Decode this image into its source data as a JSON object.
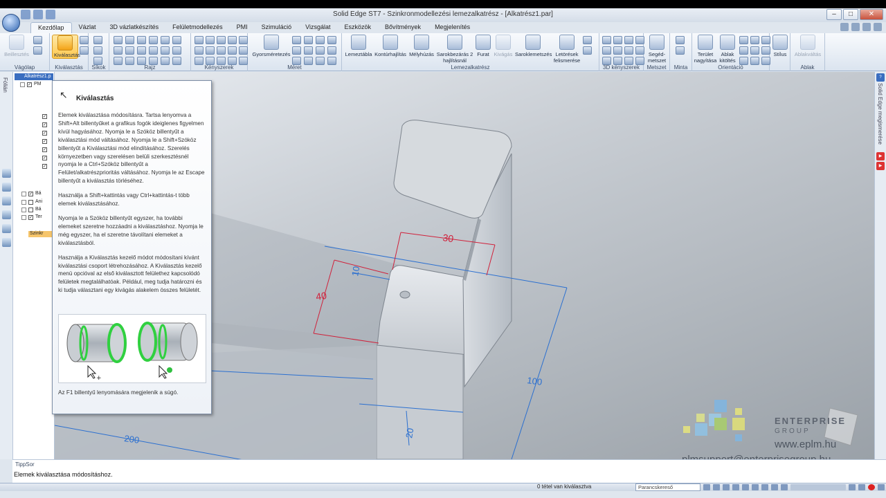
{
  "window": {
    "title": "Solid Edge ST7 - Szinkronmodellezési lemezalkatrész - [Alkatrész1.par]"
  },
  "tabs": [
    "Kezdőlap",
    "Vázlat",
    "3D vázlatkészítés",
    "Felületmodellezés",
    "PMI",
    "Szimuláció",
    "Vizsgálat",
    "Eszközök",
    "Bővítmények",
    "Megjelenítés"
  ],
  "ribbon": {
    "groups": [
      {
        "label": "Vágólap",
        "buttons": [
          "Beillesztés"
        ]
      },
      {
        "label": "Kiválasztás",
        "buttons": [
          "Kiválasztás"
        ]
      },
      {
        "label": "Síkok",
        "buttons": []
      },
      {
        "label": "Rajz",
        "buttons": []
      },
      {
        "label": "Kényszerek",
        "buttons": []
      },
      {
        "label": "Méret",
        "buttons": [
          "Gyorsméretezés"
        ]
      },
      {
        "label": "Lemezalkatrész",
        "buttons": [
          "Lemeztábla",
          "Kontúrhajlítás",
          "Mélyhúzás",
          "Sarokbezárás 2 hajlításnál",
          "Furat",
          "Kivágás",
          "Saroklemetszés",
          "Letörések felismerése"
        ]
      },
      {
        "label": "3D kényszerek",
        "buttons": []
      },
      {
        "label": "Metszet",
        "buttons": [
          "Segéd-metszet"
        ]
      },
      {
        "label": "Minta",
        "buttons": []
      },
      {
        "label": "Orientáció",
        "buttons": [
          "Terület nagyítása",
          "Ablak kitöltés"
        ]
      },
      {
        "label": "Stílus",
        "buttons": [
          "Stílus"
        ]
      },
      {
        "label": "Ablak",
        "buttons": [
          "Ablakváltás"
        ]
      }
    ]
  },
  "left_strip": {
    "label": "Fólián"
  },
  "right_strip": {
    "label": "Solid Edge megismerése"
  },
  "pathfinder": {
    "title": "Alkatrész1.p",
    "items": [
      "PM",
      "Bá",
      "Ani",
      "Bá",
      "Ter",
      "Szinkr"
    ]
  },
  "tooltip": {
    "title": "Kiválasztás",
    "paragraphs": [
      "Elemek kiválasztása módosításra.  Tartsa lenyomva a Shift+Alt billentyűket a grafikus fogók ideiglenes figyelmen kívül hagyásához. Nyomja le a Szóköz billentyűt a kiválasztási mód váltásához. Nyomja le a Shift+Szóköz billentyűt a Kiválasztási mód elindításához.  Szerelés környezetben vagy szerelésen belüli szerkesztésnél nyomja le a Ctrl+Szóköz billentyűt a Felület/alkatrészprioritás váltásához. Nyomja le az Escape billentyűt a kiválasztás törléséhez.",
      "Használja a Shift+kattintás vagy Ctrl+kattintás-t több elemek kiválasztásához.",
      "Nyomja le a Szóköz billentyűt egyszer, ha további elemeket szeretne hozzáadni a kiválasztáshoz. Nyomja le még egyszer, ha el szeretne távolítani elemeket a kiválasztásból.",
      "Használja a Kiválasztás kezelő módot módosítani kívánt kiválasztási csoport létrehozásához. A Kiválasztás kezelő menü opcióval az első kiválasztott felülethez kapcsolódó felületek megtalálhatóak. Például, meg tudja határozni és ki tudja választani egy kivágás alakelem összes felületét."
    ],
    "footer": "Az F1 billentyű lenyomására megjelenik a súgó."
  },
  "model": {
    "dimensions": [
      "30",
      "10",
      "40",
      "100",
      "200",
      "20"
    ]
  },
  "watermark": {
    "brand": "ENTERPRISE",
    "sub": "GROUP",
    "url": "www.eplm.hu",
    "email": "plmsupport@enterprisegroup.hu"
  },
  "tipsor": {
    "label": "TippSor",
    "text": "Elemek kiválasztása módosításhoz."
  },
  "status": {
    "selection": "0 tétel van kiválasztva",
    "command_finder": "Parancskereső"
  },
  "colors": {
    "accent": "#3a6ec0",
    "dimension": "#d0203a",
    "dimension_line": "#2a6fd0",
    "active_button": "#ffc84d"
  }
}
